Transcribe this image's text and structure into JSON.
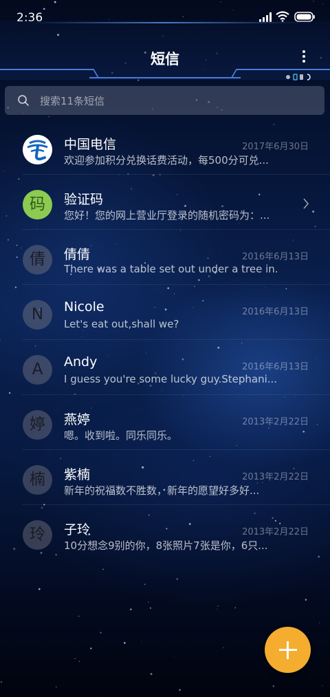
{
  "status_bar": {
    "time": "2:36"
  },
  "header": {
    "title": "短信"
  },
  "search": {
    "placeholder": "搜索11条短信"
  },
  "conversations": [
    {
      "name": "中国电信",
      "avatar": "china-telecom-logo",
      "date": "2017年6月30日",
      "preview": "欢迎参加积分兑换话费活动，每500分可兑..."
    },
    {
      "name": "验证码",
      "avatar": "码",
      "date": "",
      "preview": "您好！您的网上营业厅登录的随机密码为：..."
    },
    {
      "name": "倩倩",
      "avatar": "倩",
      "date": "2016年6月13日",
      "preview": "There was a table set out under a tree in..."
    },
    {
      "name": "Nicole",
      "avatar": "N",
      "date": "2016年6月13日",
      "preview": "Let's eat out,shall we?"
    },
    {
      "name": "Andy",
      "avatar": "A",
      "date": "2016年6月13日",
      "preview": "I guess you're some lucky guy.Stephani..."
    },
    {
      "name": "燕婷",
      "avatar": "婷",
      "date": "2013年2月22日",
      "preview": "嗯。收到啦。同乐同乐。"
    },
    {
      "name": "紫楠",
      "avatar": "楠",
      "date": "2013年2月22日",
      "preview": "新年的祝福数不胜数，新年的愿望好多好..."
    },
    {
      "name": "子玲",
      "avatar": "玲",
      "date": "2013年2月22日",
      "preview": "10分想念9别的你，8张照片7张是你，6只..."
    }
  ],
  "colors": {
    "fab": "#f4ad2e",
    "verify_avatar": "#8ccb52",
    "telecom_blue": "#1565c0"
  }
}
